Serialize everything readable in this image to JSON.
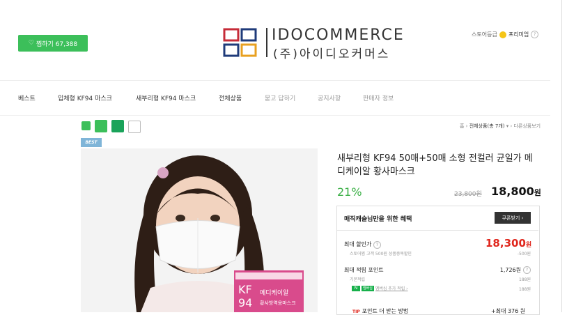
{
  "header": {
    "wishlist_label": "찜하기 67,388",
    "logo_en": "IDOCOMMERCE",
    "logo_ko": "(주)아이디오커머스",
    "store_grade_label": "스토어등급",
    "store_grade_value": "프리미엄",
    "help": "?"
  },
  "nav": {
    "items": [
      "베스트",
      "입체형 KF94 마스크",
      "새부리형 KF94 마스크",
      "전체상품",
      "묻고 답하기",
      "공지사항",
      "판매자 정보"
    ]
  },
  "breadcrumb": {
    "home": "홈",
    "current": "전체상품(총 7개)",
    "arrow": "▾",
    "next": "다른상품보기"
  },
  "badge": {
    "best": "BEST"
  },
  "product": {
    "title": "새부리형 KF94 50매+50매 소형 전컬러 균일가 메디케이알 황사마스크",
    "discount": "21%",
    "original_price": "23,800원",
    "price": "18,800",
    "price_unit": "원"
  },
  "benefits": {
    "title": "매직캐슬님만을 위한 혜택",
    "coupon_label": "쿠폰받기 ›",
    "max_discount_label": "최대 할인가",
    "max_discount_value": "18,300",
    "max_discount_unit": "원",
    "discount_detail": "스토어찜 고객 500원 상품중복할인",
    "discount_detail_value": "-500원",
    "max_points_label": "최대 적립 포인트",
    "max_points_value": "1,726원",
    "base_points_label": "기본적립",
    "base_points_value": "188원",
    "npay_label": "N",
    "npay_extra": "멤버십",
    "membership_label": "멤버십 추가 적립 ›",
    "membership_value": "188원",
    "tip_tag": "TIP",
    "tip_label": "포인트 더 받는 방법",
    "tip_value": "+최대 376 원"
  },
  "photo": {
    "box_text_1": "KF",
    "box_text_2": "94",
    "box_brand": "메디케이알",
    "box_sub": "황사방역용마스크"
  },
  "colors": {
    "accent_green": "#3cbf5a",
    "price_red": "#e0261c"
  }
}
